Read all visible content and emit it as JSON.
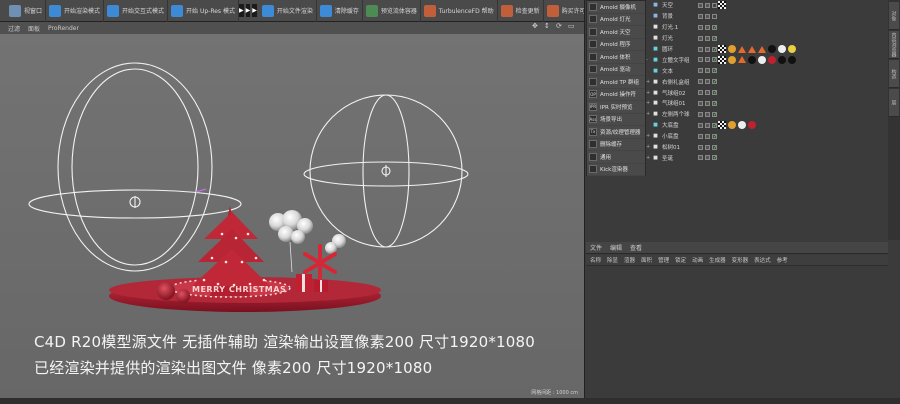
{
  "toolbar": {
    "items": [
      {
        "label": "视窗口",
        "color": "#6f8fb5"
      },
      {
        "label": "开始渲染模式",
        "color": "#3d8ad6"
      },
      {
        "label": "开始交互式模式",
        "color": "#3d8ad6"
      },
      {
        "label": "开始 Up-Res 模式",
        "color": "#3d8ad6"
      },
      {
        "label": "开始文件渲染",
        "color": "#3d8ad6"
      },
      {
        "label": "清除缓存",
        "color": "#3d8ad6"
      },
      {
        "label": "预览流体容器",
        "color": "#4c8c54"
      },
      {
        "label": "TurbulenceFD 帮助",
        "color": "#c05f3a"
      },
      {
        "label": "检查更新",
        "color": "#c05f3a"
      },
      {
        "label": "购买许可证",
        "color": "#c05f3a"
      }
    ]
  },
  "viewport": {
    "menu": [
      "过滤",
      "面板",
      "ProRender"
    ],
    "status": "网格间距 : 1000 cm",
    "scene_text": "MERRY CHRISTMAS"
  },
  "captions": [
    "C4D R20模型源文件 无插件辅助 渲染输出设置像素200 尺寸1920*1080",
    "已经渲染并提供的渲染出图文件   像素200  尺寸1920*1080"
  ],
  "arnold_menu": [
    {
      "label": "Arnold 摄像机",
      "icon": "camera-icon"
    },
    {
      "label": "Arnold 灯光",
      "icon": "light-icon"
    },
    {
      "label": "Arnold 天空",
      "icon": "sky-icon"
    },
    {
      "label": "Arnold 程序",
      "icon": "procedural-icon"
    },
    {
      "label": "Arnold 体积",
      "icon": "volume-icon"
    },
    {
      "label": "Arnold 驱动",
      "icon": "driver-icon"
    },
    {
      "label": "Arnold TP 群组",
      "icon": "tp-group-icon"
    },
    {
      "label": "Arnold 操作符",
      "icon": "operator-icon",
      "badge": "OP"
    },
    {
      "label": "IPR 实时预览",
      "icon": "ipr-icon",
      "badge": "IPR"
    },
    {
      "label": "场景导出",
      "icon": "export-icon",
      "badge": "Ass"
    },
    {
      "label": "资源/纹理管理器",
      "icon": "texture-manager-icon",
      "badge": "Tx"
    },
    {
      "label": "删除缓存",
      "icon": "trash-icon"
    },
    {
      "label": "通用",
      "icon": "lock-icon"
    },
    {
      "label": "Kick渲染器",
      "icon": "kick-icon"
    }
  ],
  "objects": [
    {
      "name": "天空",
      "icon": "sky-object-icon",
      "color": "#8fb4e0",
      "expand": "",
      "checked": false,
      "tags": [
        "tex"
      ]
    },
    {
      "name": "背景",
      "icon": "background-object-icon",
      "color": "#8fb4e0",
      "expand": "",
      "checked": false,
      "tags": []
    },
    {
      "name": "灯光.1",
      "icon": "light-object-icon",
      "color": "#e0e0e0",
      "expand": "",
      "checked": true,
      "tags": []
    },
    {
      "name": "灯光",
      "icon": "light-object-icon",
      "color": "#e0e0e0",
      "expand": "",
      "checked": true,
      "tags": []
    },
    {
      "name": "圆环",
      "icon": "torus-object-icon",
      "color": "#6ad0e0",
      "expand": "",
      "checked": true,
      "tags": [
        "checker",
        "dots",
        "tri",
        "tri",
        "tri",
        "black",
        "white",
        "yellow"
      ]
    },
    {
      "name": "立體文字组",
      "icon": "group-object-icon",
      "color": "#6ad0e0",
      "expand": "-",
      "checked": true,
      "tags": [
        "checker",
        "dots",
        "tri",
        "black",
        "white",
        "red",
        "black",
        "black"
      ]
    },
    {
      "name": "文本",
      "icon": "text-object-icon",
      "color": "#6ad0e0",
      "expand": "",
      "checked": true,
      "tags": []
    },
    {
      "name": "右侧礼盒组",
      "icon": "null-object-icon",
      "color": "#e0e0e0",
      "expand": "+",
      "checked": true,
      "tags": []
    },
    {
      "name": "气球组02",
      "icon": "null-object-icon",
      "color": "#e0e0e0",
      "expand": "+",
      "checked": true,
      "tags": []
    },
    {
      "name": "气球组01",
      "icon": "null-object-icon",
      "color": "#e0e0e0",
      "expand": "+",
      "checked": true,
      "tags": []
    },
    {
      "name": "左侧两个球",
      "icon": "null-object-icon",
      "color": "#e0e0e0",
      "expand": "+",
      "checked": true,
      "tags": []
    },
    {
      "name": "大底盘",
      "icon": "sphere-object-icon",
      "color": "#6ad0e0",
      "expand": "",
      "checked": true,
      "tags": [
        "checker",
        "dots",
        "white",
        "red"
      ]
    },
    {
      "name": "小底盘",
      "icon": "null-object-icon",
      "color": "#e0e0e0",
      "expand": "+",
      "checked": true,
      "tags": []
    },
    {
      "name": "松树01",
      "icon": "null-object-icon",
      "color": "#e0e0e0",
      "expand": "+",
      "checked": true,
      "tags": []
    },
    {
      "name": "圣诞",
      "icon": "null-object-icon",
      "color": "#e0e0e0",
      "expand": "+",
      "checked": true,
      "tags": []
    }
  ],
  "attribute_manager": {
    "tabs": [
      "文件",
      "编辑",
      "查看"
    ],
    "columns": [
      "名称",
      "除显",
      "渲器",
      "面积",
      "管理",
      "锁定",
      "动画",
      "生成器",
      "变形器",
      "表达式",
      "参考"
    ]
  },
  "side_tabs": [
    "对象",
    "内容浏览器",
    "构造",
    "层"
  ],
  "colors": {
    "accent": "#c8243a",
    "viewport_bg": "#6f6f6f",
    "panel_bg": "#3b3b3b"
  }
}
